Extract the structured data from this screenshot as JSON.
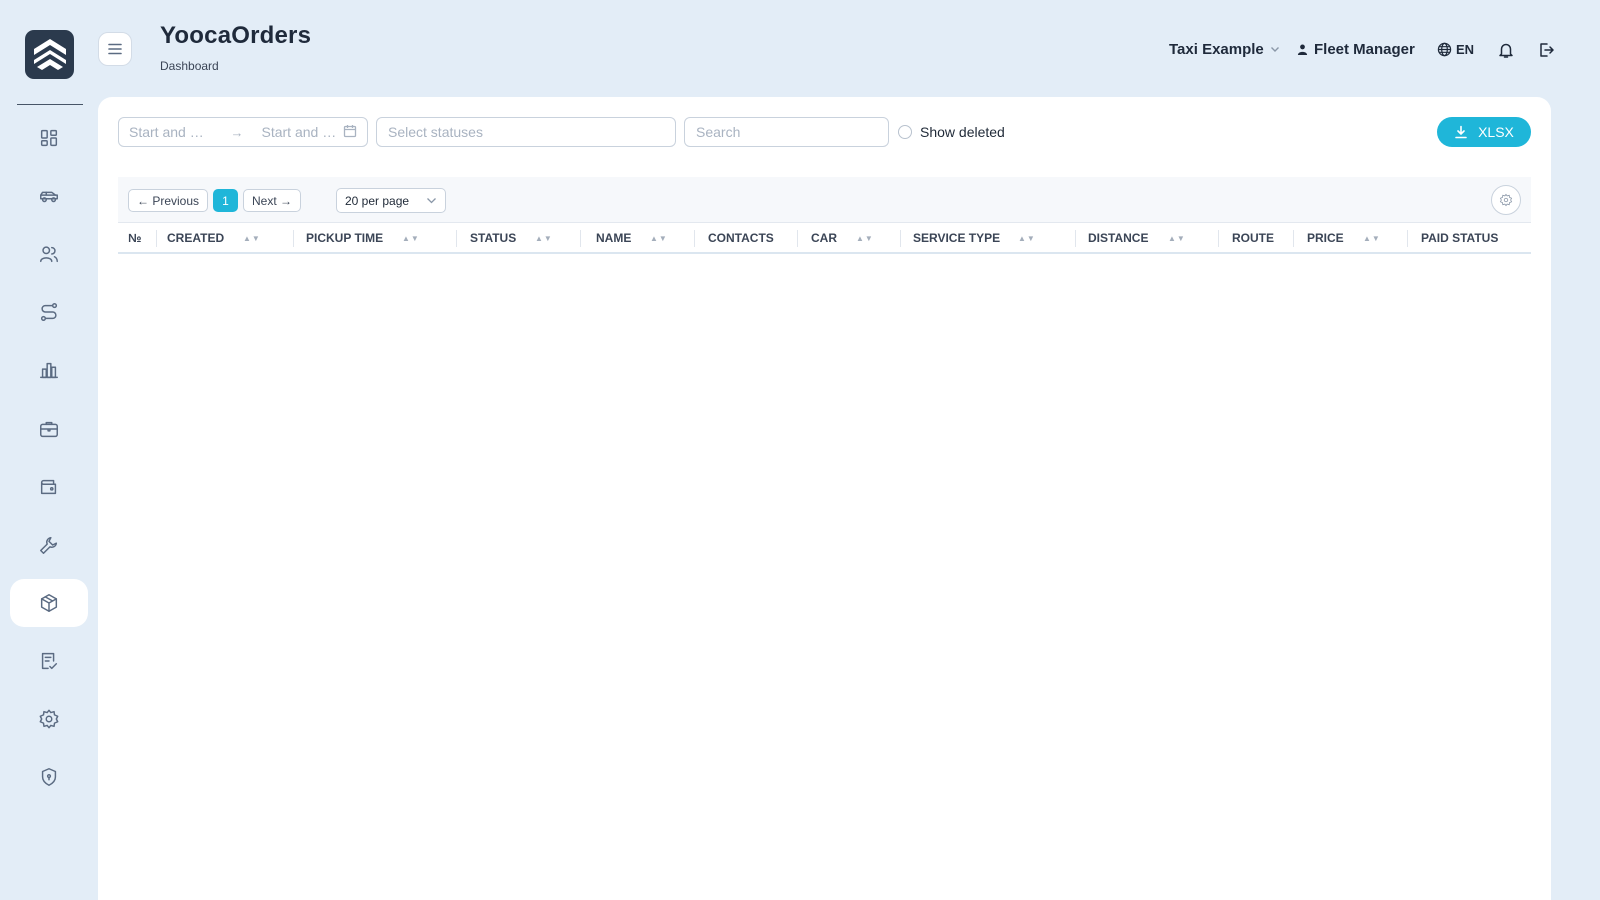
{
  "header": {
    "app_title": "YoocaOrders",
    "breadcrumb": "Dashboard",
    "company": "Taxi Example",
    "role": "Fleet Manager",
    "language": "EN"
  },
  "sidebar": {
    "items": [
      {
        "icon": "dashboard-icon",
        "active": false
      },
      {
        "icon": "car-icon",
        "active": false
      },
      {
        "icon": "users-icon",
        "active": false
      },
      {
        "icon": "route-icon",
        "active": false
      },
      {
        "icon": "bar-chart-icon",
        "active": false
      },
      {
        "icon": "briefcase-icon",
        "active": false
      },
      {
        "icon": "wallet-icon",
        "active": false
      },
      {
        "icon": "wrench-icon",
        "active": false
      },
      {
        "icon": "package-icon",
        "active": true
      },
      {
        "icon": "checklist-icon",
        "active": false
      },
      {
        "icon": "gear-icon",
        "active": false
      },
      {
        "icon": "shield-icon",
        "active": false
      }
    ]
  },
  "filters": {
    "start_placeholder": "Start and E…",
    "end_placeholder": "Start and E…",
    "range_arrow": "→",
    "statuses_placeholder": "Select statuses",
    "search_placeholder": "Search",
    "show_deleted_label": "Show deleted",
    "export_label": "XLSX"
  },
  "pagination": {
    "previous_label": "← Previous",
    "current_page": "1",
    "next_label": "Next →",
    "per_page": "20 per page"
  },
  "table": {
    "columns": [
      {
        "label": "№",
        "sortable": false
      },
      {
        "label": "CREATED",
        "sortable": true
      },
      {
        "label": "PICKUP TIME",
        "sortable": true
      },
      {
        "label": "STATUS",
        "sortable": true
      },
      {
        "label": "NAME",
        "sortable": true
      },
      {
        "label": "CONTACTS",
        "sortable": false
      },
      {
        "label": "CAR",
        "sortable": true
      },
      {
        "label": "SERVICE TYPE",
        "sortable": true
      },
      {
        "label": "DISTANCE",
        "sortable": true
      },
      {
        "label": "ROUTE",
        "sortable": false
      },
      {
        "label": "PRICE",
        "sortable": true
      },
      {
        "label": "PAID STATUS",
        "sortable": false
      }
    ],
    "sort_glyph": "▲▼",
    "rows": []
  },
  "colors": {
    "accent": "#1fb6d9",
    "background": "#e3edf7",
    "logo": "#2b3a4d"
  }
}
